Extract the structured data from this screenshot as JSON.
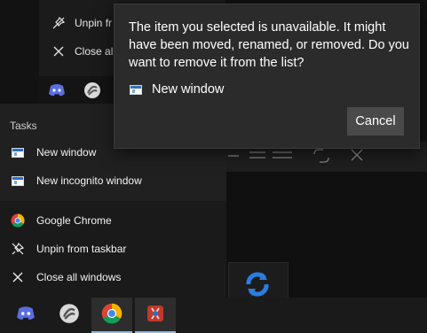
{
  "background_menu": {
    "items": [
      {
        "label": "Unpin fr",
        "icon": "unpin-icon"
      },
      {
        "label": "Close all",
        "icon": "close-icon"
      }
    ],
    "taskbar_icons": [
      "discord-icon",
      "app-ring-icon"
    ]
  },
  "jump_list": {
    "tasks_header": "Tasks",
    "tasks": [
      {
        "label": "New window",
        "icon": "window-icon"
      },
      {
        "label": "New incognito window",
        "icon": "window-icon"
      }
    ],
    "pinned": [
      {
        "label": "Google Chrome",
        "icon": "chrome-icon"
      },
      {
        "label": "Unpin from taskbar",
        "icon": "unpin-icon"
      },
      {
        "label": "Close all windows",
        "icon": "close-icon"
      }
    ]
  },
  "dialog": {
    "message": "The item you selected is unavailable. It might have been moved, renamed, or removed. Do you want to remove it from the list?",
    "item_label": "New window",
    "cancel_label": "Cancel"
  },
  "taskbar": {
    "apps": [
      {
        "name": "discord-icon",
        "active": false
      },
      {
        "name": "app-ring-icon",
        "active": false
      },
      {
        "name": "chrome-icon",
        "active": true
      },
      {
        "name": "tools-app-icon",
        "active": true
      }
    ],
    "accent": "#8fb8e0"
  }
}
